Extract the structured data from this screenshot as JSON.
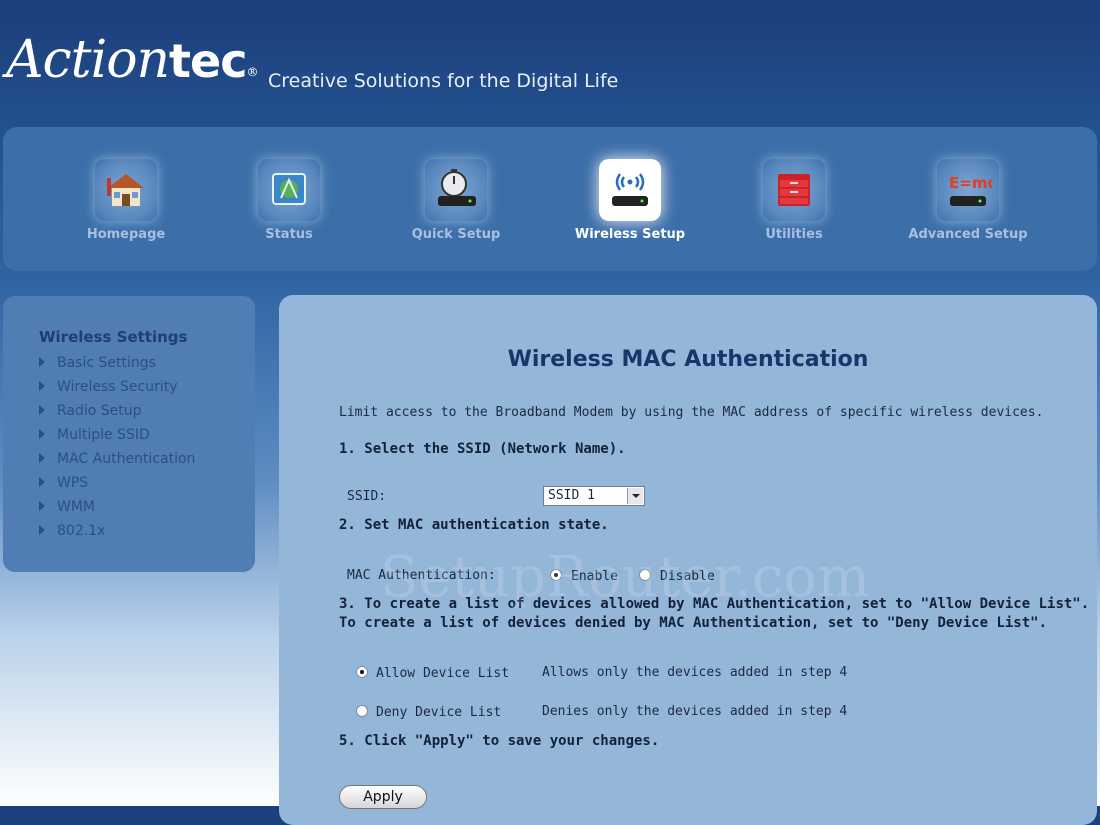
{
  "brand": {
    "logo_script": "Action",
    "logo_bold": "tec",
    "logo_mark": "®",
    "tagline": "Creative Solutions for the Digital Life"
  },
  "nav": {
    "items": [
      {
        "label": "Homepage",
        "icon": "house-icon"
      },
      {
        "label": "Status",
        "icon": "status-icon"
      },
      {
        "label": "Quick Setup",
        "icon": "stopwatch-modem-icon"
      },
      {
        "label": "Wireless Setup",
        "icon": "wireless-modem-icon",
        "active": true
      },
      {
        "label": "Utilities",
        "icon": "toolbox-icon"
      },
      {
        "label": "Advanced Setup",
        "icon": "emc2-modem-icon"
      }
    ]
  },
  "sidebar": {
    "title": "Wireless Settings",
    "items": [
      {
        "label": "Basic Settings"
      },
      {
        "label": "Wireless Security"
      },
      {
        "label": "Radio Setup"
      },
      {
        "label": "Multiple SSID"
      },
      {
        "label": "MAC Authentication"
      },
      {
        "label": "WPS"
      },
      {
        "label": "WMM"
      },
      {
        "label": "802.1x"
      }
    ]
  },
  "main": {
    "title": "Wireless MAC Authentication",
    "intro": "Limit access to the Broadband Modem by using the MAC address of specific wireless devices.",
    "step1": "1. Select the SSID (Network Name).",
    "ssid_label": "SSID:",
    "ssid_value": "SSID 1",
    "step2": "2. Set MAC authentication state.",
    "mac_auth_label": "MAC Authentication:",
    "enable_label": "Enable",
    "disable_label": "Disable",
    "mac_auth_state": "Enable",
    "step3_line1": "3. To create a list of devices allowed by MAC Authentication, set to \"Allow Device List\".",
    "step3_line2": "To create a list of devices denied by MAC Authentication, set to \"Deny Device List\".",
    "allow_label": "Allow Device List",
    "allow_desc": "Allows only the devices added in step 4",
    "deny_label": "Deny Device List",
    "deny_desc": "Denies only the devices added in step 4",
    "list_mode": "Allow Device List",
    "step5": "5. Click \"Apply\" to save your changes.",
    "apply_label": "Apply"
  },
  "watermark": "SetupRouter.com",
  "colors": {
    "header_bg": "#1b3f7a",
    "nav_bg": "#3c6ea9",
    "panel_bg": "#94b6d9",
    "sidebar_bg": "#4f7db4",
    "title_color": "#1a356a"
  }
}
